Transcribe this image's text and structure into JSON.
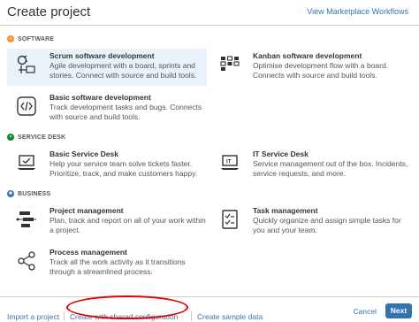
{
  "header": {
    "title": "Create project",
    "marketplace_link": "View Marketplace Workflows"
  },
  "sections": [
    {
      "label": "SOFTWARE",
      "icon": "code-icon",
      "color": "#f79232",
      "items": [
        {
          "title": "Scrum software development",
          "description": "Agile development with a board, sprints and stories. Connect with source and build tools.",
          "icon": "scrum-board-icon",
          "selected": true
        },
        {
          "title": "Kanban software development",
          "description": "Optimise development flow with a board. Connects with source and build tools.",
          "icon": "kanban-board-icon",
          "selected": false
        },
        {
          "title": "Basic software development",
          "description": "Track development tasks and bugs. Connects with source and build tools.",
          "icon": "code-brackets-icon",
          "selected": false
        }
      ]
    },
    {
      "label": "SERVICE DESK",
      "icon": "service-desk-icon",
      "color": "#14892c",
      "items": [
        {
          "title": "Basic Service Desk",
          "description": "Help your service team solve tickets faster. Prioritize, track, and make customers happy.",
          "icon": "laptop-support-icon",
          "selected": false
        },
        {
          "title": "IT Service Desk",
          "description": "Service management out of the box. Incidents, service requests, and more.",
          "icon": "it-laptop-icon",
          "selected": false
        }
      ]
    },
    {
      "label": "BUSINESS",
      "icon": "business-icon",
      "color": "#3b73af",
      "items": [
        {
          "title": "Project management",
          "description": "Plan, track and report on all of your work within a project.",
          "icon": "project-timeline-icon",
          "selected": false
        },
        {
          "title": "Task management",
          "description": "Quickly organize and assign simple tasks for you and your team.",
          "icon": "task-list-icon",
          "selected": false
        },
        {
          "title": "Process management",
          "description": "Track all the work activity as it transitions through a streamlined process.",
          "icon": "process-flow-icon",
          "selected": false
        }
      ]
    }
  ],
  "footer": {
    "import_link": "Import a project",
    "shared_config_link": "Create with shared configuration",
    "sample_data_link": "Create sample data",
    "next_button": "Next",
    "cancel_link": "Cancel"
  },
  "colors": {
    "link": "#3b73af",
    "primary_button": "#3572b0",
    "selected_bg": "#e9f2fa",
    "annotation": "#e00000"
  }
}
